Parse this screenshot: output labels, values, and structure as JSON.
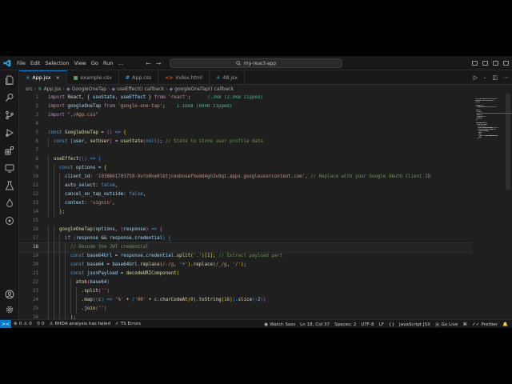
{
  "menu": [
    "File",
    "Edit",
    "Selection",
    "View",
    "Go",
    "Run"
  ],
  "more_menu_label": "…",
  "nav": {
    "back": "←",
    "forward": "→"
  },
  "search": {
    "text": "my-react-app"
  },
  "tabs": [
    {
      "icon": "react-icon",
      "glyph": "⚛",
      "color": "#61dafb",
      "label": "App.jsx",
      "active": true
    },
    {
      "icon": "csv-icon",
      "glyph": "▦",
      "color": "#89d185",
      "label": "example.csv",
      "active": false
    },
    {
      "icon": "css-icon",
      "glyph": "#",
      "color": "#42a5f5",
      "label": "App.css",
      "active": false
    },
    {
      "icon": "html-icon",
      "glyph": "<>",
      "color": "#e44d26",
      "label": "index.html",
      "active": false
    },
    {
      "icon": "react-icon",
      "glyph": "⚛",
      "color": "#61dafb",
      "label": "48.jsx",
      "active": false
    }
  ],
  "breadcrumb": [
    "src",
    "App.jsx",
    "GoogleOneTap",
    "useEffect() callback",
    "googleOneTap() callback"
  ],
  "editor": {
    "current_line": 18,
    "lines": [
      {
        "n": 1,
        "tokens": [
          [
            "import",
            "kw"
          ],
          [
            " React, { ",
            "p"
          ],
          [
            "useState",
            "var"
          ],
          [
            ", ",
            "p"
          ],
          [
            "useEffect",
            "var"
          ],
          [
            " } ",
            "p"
          ],
          [
            "from",
            "kw"
          ],
          [
            " ",
            "p"
          ],
          [
            "'react'",
            "str"
          ],
          [
            ";",
            "p"
          ],
          [
            "      7.3kB (2.9kB zipped)",
            "hint"
          ]
        ]
      },
      {
        "n": 2,
        "tokens": [
          [
            "import",
            "kw"
          ],
          [
            " ",
            "p"
          ],
          [
            "googleOneTap",
            "var"
          ],
          [
            " ",
            "p"
          ],
          [
            "from",
            "kw"
          ],
          [
            " ",
            "p"
          ],
          [
            "'google-one-tap'",
            "str"
          ],
          [
            ";",
            "p"
          ],
          [
            "    1.16kB (604B zipped)",
            "hint"
          ]
        ]
      },
      {
        "n": 3,
        "tokens": [
          [
            "import",
            "kw"
          ],
          [
            " ",
            "p"
          ],
          [
            "\"./App.css\"",
            "str"
          ]
        ]
      },
      {
        "n": 4,
        "tokens": []
      },
      {
        "n": 5,
        "tokens": [
          [
            "const",
            "kw2"
          ],
          [
            " ",
            "p"
          ],
          [
            "GoogleOneTap",
            "fn"
          ],
          [
            " = ",
            "p"
          ],
          [
            "()",
            "br2"
          ],
          [
            " => ",
            "kw2"
          ],
          [
            "{",
            "br1"
          ]
        ]
      },
      {
        "n": 6,
        "tokens": [
          [
            "  ",
            "p"
          ],
          [
            "const",
            "kw2"
          ],
          [
            " ",
            "p"
          ],
          [
            "[",
            "br2"
          ],
          [
            "user",
            "var"
          ],
          [
            ", ",
            "p"
          ],
          [
            "setUser",
            "fn"
          ],
          [
            "]",
            "br2"
          ],
          [
            " = ",
            "p"
          ],
          [
            "useState",
            "fn"
          ],
          [
            "(",
            "br2"
          ],
          [
            "null",
            "kw2"
          ],
          [
            ")",
            "br2"
          ],
          [
            "; ",
            "p"
          ],
          [
            "// State to store user profile data",
            "cmt"
          ]
        ]
      },
      {
        "n": 7,
        "tokens": []
      },
      {
        "n": 8,
        "tokens": [
          [
            "  ",
            "p"
          ],
          [
            "useEffect",
            "fn"
          ],
          [
            "(",
            "br2"
          ],
          [
            "()",
            "br3"
          ],
          [
            " => ",
            "kw2"
          ],
          [
            "{",
            "br3"
          ]
        ]
      },
      {
        "n": 9,
        "tokens": [
          [
            "    ",
            "p"
          ],
          [
            "const",
            "kw2"
          ],
          [
            " ",
            "p"
          ],
          [
            "options",
            "var"
          ],
          [
            " = ",
            "p"
          ],
          [
            "{",
            "br1"
          ]
        ]
      },
      {
        "n": 10,
        "tokens": [
          [
            "      ",
            "p"
          ],
          [
            "client_id",
            "var"
          ],
          [
            ": ",
            "p"
          ],
          [
            "'10388617037S9-9vro0ne0lbtjcenbosefhomd4gh3v8qi.apps.googleusercontent.com'",
            "str"
          ],
          [
            ", ",
            "p"
          ],
          [
            "// Replace with your Google OAuth Client ID",
            "cmt"
          ]
        ]
      },
      {
        "n": 11,
        "tokens": [
          [
            "      ",
            "p"
          ],
          [
            "auto_select",
            "var"
          ],
          [
            ": ",
            "p"
          ],
          [
            "false",
            "kw2"
          ],
          [
            ",",
            "p"
          ]
        ]
      },
      {
        "n": 12,
        "tokens": [
          [
            "      ",
            "p"
          ],
          [
            "cancel_on_tap_outside",
            "var"
          ],
          [
            ": ",
            "p"
          ],
          [
            "false",
            "kw2"
          ],
          [
            ",",
            "p"
          ]
        ]
      },
      {
        "n": 13,
        "tokens": [
          [
            "      ",
            "p"
          ],
          [
            "context",
            "var"
          ],
          [
            ": ",
            "p"
          ],
          [
            "'signin'",
            "str"
          ],
          [
            ",",
            "p"
          ]
        ]
      },
      {
        "n": 14,
        "tokens": [
          [
            "    ",
            "p"
          ],
          [
            "}",
            "br1"
          ],
          [
            ";",
            "p"
          ]
        ]
      },
      {
        "n": 15,
        "tokens": []
      },
      {
        "n": 16,
        "tokens": [
          [
            "    ",
            "p"
          ],
          [
            "googleOneTap",
            "fn"
          ],
          [
            "(",
            "br1"
          ],
          [
            "options",
            "var"
          ],
          [
            ", ",
            "p"
          ],
          [
            "(",
            "br2"
          ],
          [
            "response",
            "var"
          ],
          [
            ")",
            "br2"
          ],
          [
            " => ",
            "kw2"
          ],
          [
            "{",
            "br2"
          ]
        ]
      },
      {
        "n": 17,
        "tokens": [
          [
            "      ",
            "p"
          ],
          [
            "if",
            "kw"
          ],
          [
            " ",
            "p"
          ],
          [
            "(",
            "br3"
          ],
          [
            "response",
            "var"
          ],
          [
            " && ",
            "p"
          ],
          [
            "response",
            "var"
          ],
          [
            ".",
            "p"
          ],
          [
            "credential",
            "var"
          ],
          [
            ")",
            "br3"
          ],
          [
            " ",
            "p"
          ],
          [
            "{",
            "br3"
          ]
        ]
      },
      {
        "n": 18,
        "tokens": [
          [
            "        ",
            "p"
          ],
          [
            "// Decode the JWT credential",
            "cmt"
          ]
        ]
      },
      {
        "n": 19,
        "tokens": [
          [
            "        ",
            "p"
          ],
          [
            "const",
            "kw2"
          ],
          [
            " ",
            "p"
          ],
          [
            "base64Url",
            "var"
          ],
          [
            " = ",
            "p"
          ],
          [
            "response",
            "var"
          ],
          [
            ".",
            "p"
          ],
          [
            "credential",
            "var"
          ],
          [
            ".",
            "p"
          ],
          [
            "split",
            "fn"
          ],
          [
            "(",
            "br1"
          ],
          [
            "'.'",
            "str"
          ],
          [
            ")",
            "br1"
          ],
          [
            "[",
            "br1"
          ],
          [
            "1",
            "num"
          ],
          [
            "]",
            "br1"
          ],
          [
            "; ",
            "p"
          ],
          [
            "// Extract payload part",
            "cmt"
          ]
        ]
      },
      {
        "n": 20,
        "tokens": [
          [
            "        ",
            "p"
          ],
          [
            "const",
            "kw2"
          ],
          [
            " ",
            "p"
          ],
          [
            "base64",
            "var"
          ],
          [
            " = ",
            "p"
          ],
          [
            "base64Url",
            "var"
          ],
          [
            ".",
            "p"
          ],
          [
            "replace",
            "fn"
          ],
          [
            "(",
            "br1"
          ],
          [
            "/-/g",
            "str"
          ],
          [
            ", ",
            "p"
          ],
          [
            "'+'",
            "str"
          ],
          [
            ")",
            "br1"
          ],
          [
            ".",
            "p"
          ],
          [
            "replace",
            "fn"
          ],
          [
            "(",
            "br1"
          ],
          [
            "/_/g",
            "str"
          ],
          [
            ", ",
            "p"
          ],
          [
            "'/'",
            "str"
          ],
          [
            ")",
            "br1"
          ],
          [
            ";",
            "p"
          ]
        ]
      },
      {
        "n": 21,
        "tokens": [
          [
            "        ",
            "p"
          ],
          [
            "const",
            "kw2"
          ],
          [
            " ",
            "p"
          ],
          [
            "jsonPayload",
            "var"
          ],
          [
            " = ",
            "p"
          ],
          [
            "decodeURIComponent",
            "fn"
          ],
          [
            "(",
            "br1"
          ]
        ]
      },
      {
        "n": 22,
        "tokens": [
          [
            "          ",
            "p"
          ],
          [
            "atob",
            "fn"
          ],
          [
            "(",
            "br2"
          ],
          [
            "base64",
            "var"
          ],
          [
            ")",
            "br2"
          ]
        ]
      },
      {
        "n": 23,
        "tokens": [
          [
            "            ",
            "p"
          ],
          [
            ".",
            "p"
          ],
          [
            "split",
            "fn"
          ],
          [
            "(",
            "br2"
          ],
          [
            "''",
            "str"
          ],
          [
            ")",
            "br2"
          ]
        ]
      },
      {
        "n": 24,
        "tokens": [
          [
            "            ",
            "p"
          ],
          [
            ".",
            "p"
          ],
          [
            "map",
            "fn"
          ],
          [
            "(",
            "br2"
          ],
          [
            "(",
            "br3"
          ],
          [
            "c",
            "var"
          ],
          [
            ")",
            "br3"
          ],
          [
            " => ",
            "kw2"
          ],
          [
            "'%'",
            "str"
          ],
          [
            " + ",
            "p"
          ],
          [
            "(",
            "br3"
          ],
          [
            "'00'",
            "str"
          ],
          [
            " + ",
            "p"
          ],
          [
            "c",
            "var"
          ],
          [
            ".",
            "p"
          ],
          [
            "charCodeAt",
            "fn"
          ],
          [
            "(",
            "br1"
          ],
          [
            "0",
            "num"
          ],
          [
            ")",
            "br1"
          ],
          [
            ".",
            "p"
          ],
          [
            "toString",
            "fn"
          ],
          [
            "(",
            "br1"
          ],
          [
            "16",
            "num"
          ],
          [
            ")",
            "br1"
          ],
          [
            ")",
            "br3"
          ],
          [
            ".",
            "p"
          ],
          [
            "slice",
            "fn"
          ],
          [
            "(",
            "br3"
          ],
          [
            "-2",
            "num"
          ],
          [
            ")",
            "br3"
          ],
          [
            ")",
            "br2"
          ]
        ]
      },
      {
        "n": 25,
        "tokens": [
          [
            "            ",
            "p"
          ],
          [
            ".",
            "p"
          ],
          [
            "join",
            "fn"
          ],
          [
            "(",
            "br2"
          ],
          [
            "''",
            "str"
          ],
          [
            ")",
            "br2"
          ]
        ]
      },
      {
        "n": 26,
        "tokens": [
          [
            "        ",
            "p"
          ],
          [
            ")",
            "br1"
          ],
          [
            ";",
            "p"
          ]
        ]
      }
    ]
  },
  "status": {
    "remote": "><",
    "errors": "0",
    "warnings": "0",
    "ports": "0",
    "rhda": "RHDA analysis has failed",
    "ts": "TS Errors",
    "watch": "Watch Sass",
    "position": "Ln 18, Col 37",
    "spaces": "Spaces: 2",
    "encoding": "UTF-8",
    "eol": "LF",
    "braces": "{}",
    "language": "JavaScript JSX",
    "golive": "Go Live",
    "prettier": "Prettier"
  },
  "colors": {
    "accent": "#0078d4",
    "editor_bg": "#1f1f1f",
    "chrome_bg": "#181818"
  }
}
